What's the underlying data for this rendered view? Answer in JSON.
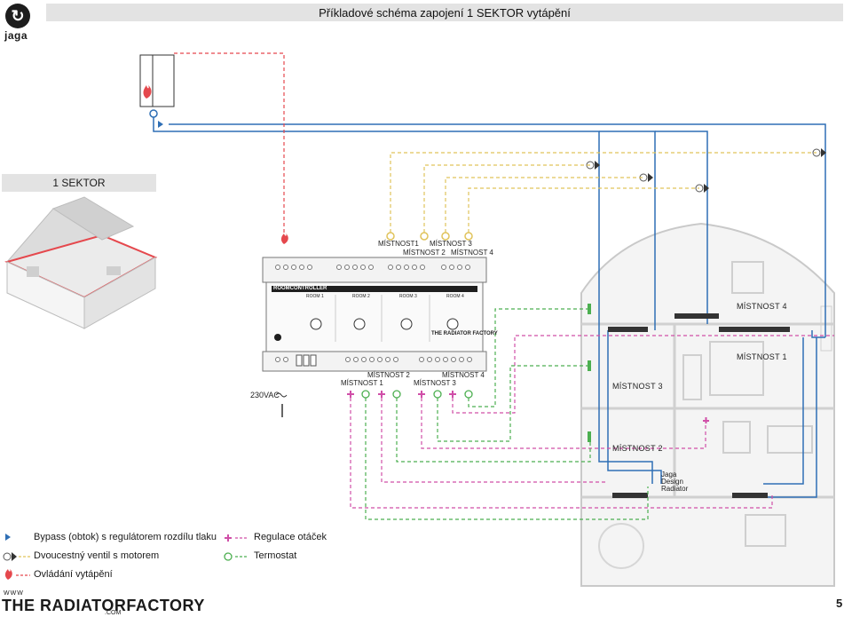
{
  "header": {
    "title": "Příkladové schéma zapojení 1 SEKTOR vytápění"
  },
  "logo": {
    "text": "jaga"
  },
  "sector": {
    "label": "1 SEKTOR"
  },
  "controller": {
    "label": "ROOMCONTROLLER",
    "rooms": [
      "ROOM 1",
      "ROOM 2",
      "ROOM 3",
      "ROOM 4"
    ],
    "brand": "THE RADIATOR FACTORY",
    "power": "230VAC"
  },
  "valve_labels": {
    "mistnost1": "MÍSTNOST1",
    "mistnost2": "MÍSTNOST 2",
    "mistnost3": "MÍSTNOST 3",
    "mistnost4": "MÍSTNOST 4"
  },
  "fan_labels": {
    "mistnost1": "MÍSTNOST 1",
    "mistnost2": "MÍSTNOST 2",
    "mistnost3": "MÍSTNOST 3",
    "mistnost4": "MÍSTNOST 4"
  },
  "floorplan": {
    "room4": "MÍSTNOST 4",
    "room1": "MÍSTNOST 1",
    "room3": "MÍSTNOST 3",
    "room2": "MÍSTNOST 2",
    "radiator_note": [
      "Jaga",
      "Design",
      "Radiator"
    ]
  },
  "legend": {
    "bypass": "Bypass (obtok) s regulátorem rozdílu tlaku",
    "valve": "Dvoucestný ventil s motorem",
    "heating": "Ovládání vytápění",
    "fan": "Regulace otáček",
    "thermostat": "Termostat"
  },
  "footer": {
    "www": "WWW",
    "brand": "THE RADIATORFACTORY",
    "com": ".COM",
    "page": "5"
  },
  "colors": {
    "pipe": "#2f6fb5",
    "heating": "#e5484d",
    "valve_ctrl": "#e0c35a",
    "fan": "#d04fa8",
    "thermo": "#4caf50"
  }
}
